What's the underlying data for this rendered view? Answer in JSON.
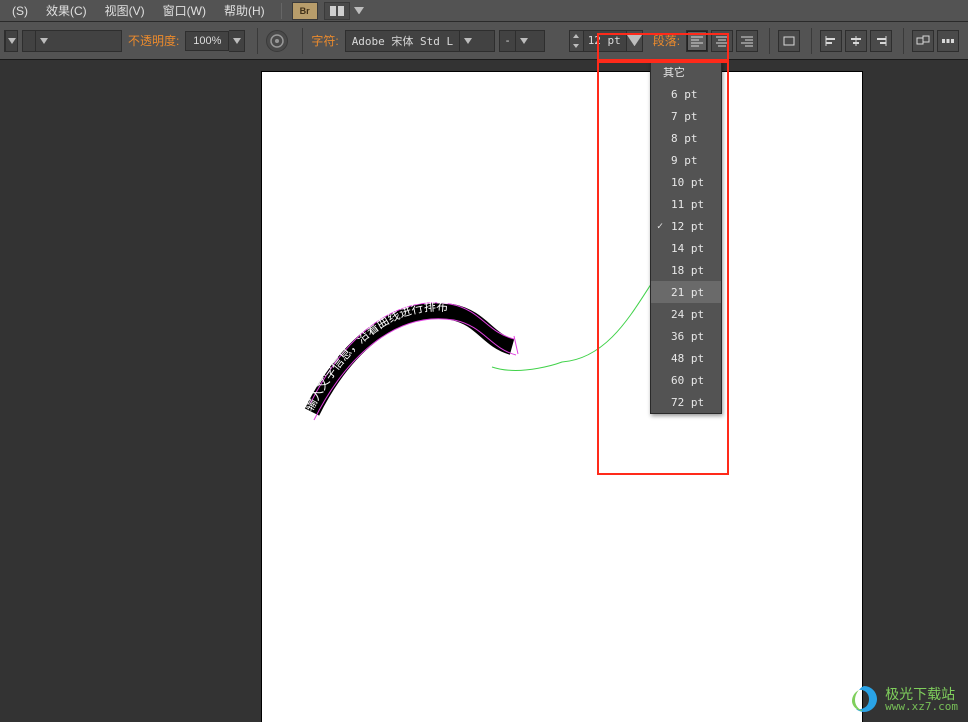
{
  "menubar": {
    "items": [
      {
        "label": "(S)"
      },
      {
        "label": "效果(C)"
      },
      {
        "label": "视图(V)"
      },
      {
        "label": "窗口(W)"
      },
      {
        "label": "帮助(H)"
      }
    ]
  },
  "optbar": {
    "opacity_label": "不透明度:",
    "opacity_value": "100%",
    "char_label": "字符:",
    "font_name": "Adobe 宋体 Std L",
    "font_variant": "-",
    "paragraph_label": "段落:",
    "font_size": "12 pt"
  },
  "font_size_menu": {
    "other": "其它",
    "items": [
      "6 pt",
      "7 pt",
      "8 pt",
      "9 pt",
      "10 pt",
      "11 pt",
      "12 pt",
      "14 pt",
      "18 pt",
      "21 pt",
      "24 pt",
      "36 pt",
      "48 pt",
      "60 pt",
      "72 pt"
    ],
    "checked": "12 pt",
    "hovered": "21 pt"
  },
  "canvas": {
    "path_text": "输入文字信息，沿着曲线进行排布"
  },
  "watermark": {
    "line1": "极光下载站",
    "line2": "www.xz7.com"
  }
}
